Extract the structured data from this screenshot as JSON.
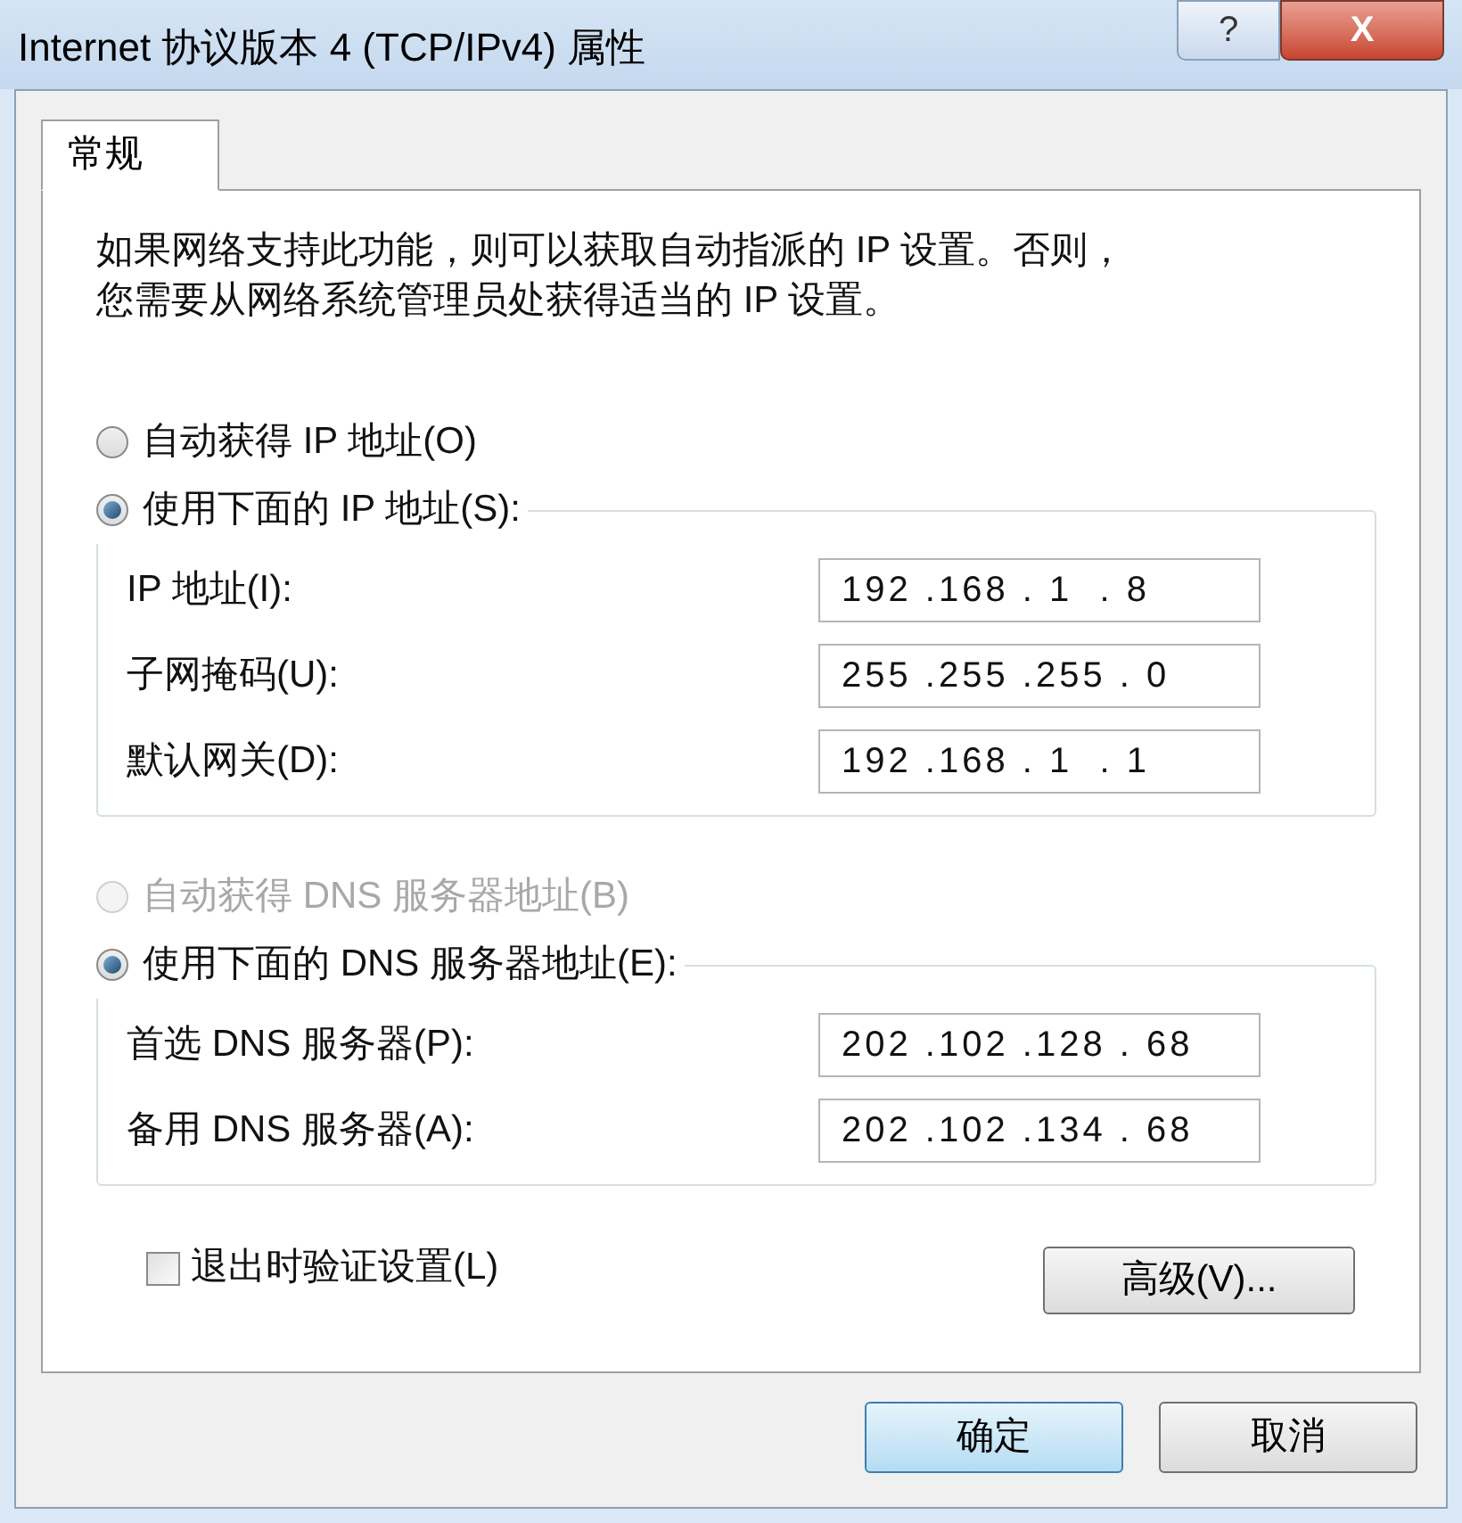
{
  "window": {
    "title": "Internet 协议版本 4 (TCP/IPv4) 属性",
    "buttons": [
      {
        "kind": "help",
        "label": "?"
      },
      {
        "kind": "close",
        "label": "X"
      }
    ]
  },
  "tabs": [
    {
      "label": "常规",
      "selected": true
    }
  ],
  "description": [
    "如果网络支持此功能，则可以获取自动指派的 IP 设置。否则，",
    "您需要从网络系统管理员处获得适当的 IP 设置。"
  ],
  "ip_section": {
    "options": [
      {
        "label": "自动获得 IP 地址(O)",
        "selected": false,
        "disabled": false
      },
      {
        "label": "使用下面的 IP 地址(S):",
        "selected": true,
        "disabled": false
      }
    ],
    "fields": [
      {
        "label": "IP 地址(I):",
        "value": "192 .168 . 1  . 8"
      },
      {
        "label": "子网掩码(U):",
        "value": "255 .255 .255 . 0"
      },
      {
        "label": "默认网关(D):",
        "value": "192 .168 . 1  . 1"
      }
    ]
  },
  "dns_section": {
    "options": [
      {
        "label": "自动获得 DNS 服务器地址(B)",
        "selected": false,
        "disabled": true
      },
      {
        "label": "使用下面的 DNS 服务器地址(E):",
        "selected": true,
        "disabled": false
      }
    ],
    "fields": [
      {
        "label": "首选 DNS 服务器(P):",
        "value": "202 .102 .128 . 68"
      },
      {
        "label": "备用 DNS 服务器(A):",
        "value": "202 .102 .134 . 68"
      }
    ]
  },
  "validate_checkbox": {
    "label": "退出时验证设置(L)",
    "checked": false
  },
  "advanced_button": "高级(V)...",
  "buttons": [
    {
      "label": "确定",
      "default": true
    },
    {
      "label": "取消",
      "default": false
    }
  ]
}
